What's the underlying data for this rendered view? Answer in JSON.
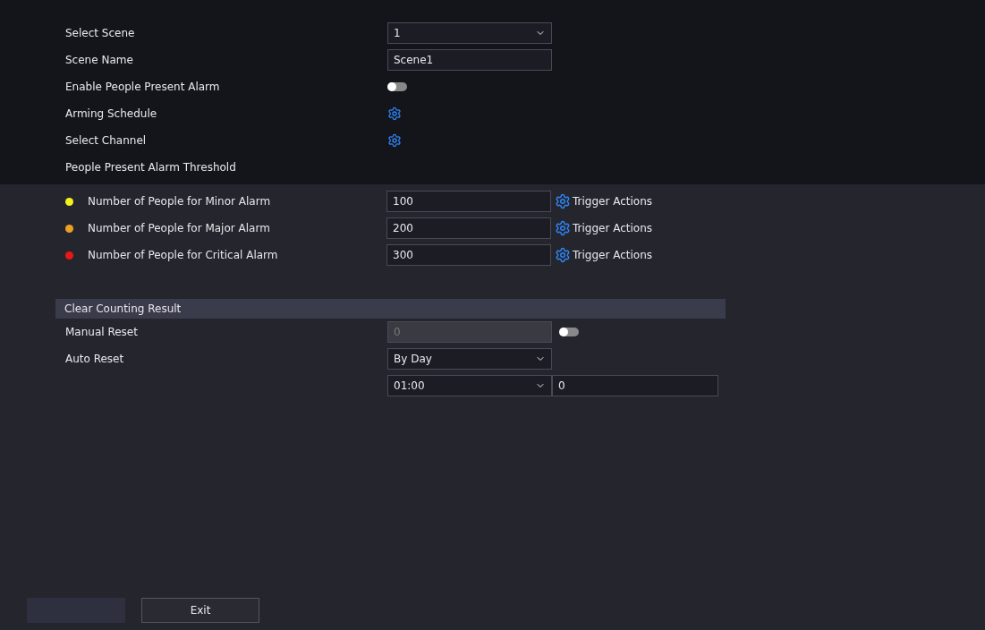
{
  "settings": [
    {
      "kind": "select",
      "label": "Select Scene",
      "value": "1"
    },
    {
      "kind": "text",
      "label": "Scene Name",
      "value": "Scene1"
    },
    {
      "kind": "toggle",
      "label": "Enable People Present Alarm",
      "on": false
    },
    {
      "kind": "gear",
      "label": "Arming Schedule"
    },
    {
      "kind": "gear",
      "label": "Select Channel"
    }
  ],
  "threshold": {
    "title": "People Present Alarm Threshold",
    "rows": [
      {
        "label": "Number of People for Minor Alarm",
        "color": "#f2f21c",
        "value": "100",
        "action": "Trigger Actions"
      },
      {
        "label": "Number of People for Major Alarm",
        "color": "#f0a020",
        "value": "200",
        "action": "Trigger Actions"
      },
      {
        "label": "Number of People for Critical Alarm",
        "color": "#e81818",
        "value": "300",
        "action": "Trigger Actions"
      }
    ]
  },
  "clear": {
    "title": "Clear Counting Result",
    "manual": {
      "label": "Manual Reset",
      "value": "0",
      "disabled": true,
      "on": false
    },
    "auto": {
      "label": "Auto Reset",
      "mode": "By Day",
      "time": "01:00",
      "minute": "0"
    }
  },
  "buttons": [
    {
      "label": "Exit"
    }
  ]
}
